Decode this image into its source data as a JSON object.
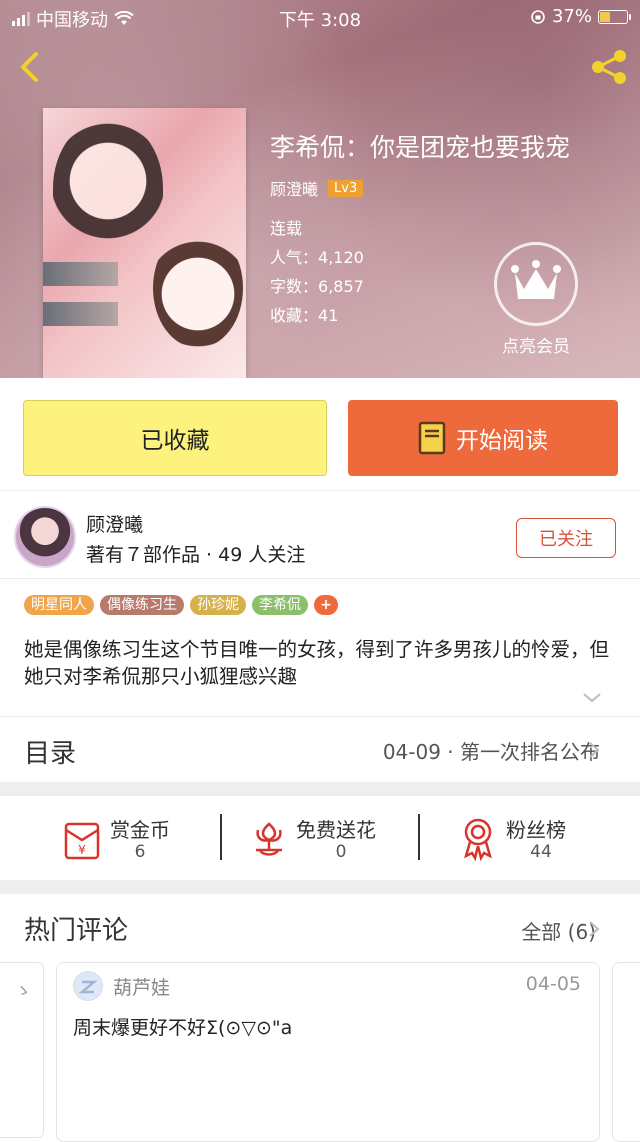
{
  "status_bar": {
    "carrier": "中国移动",
    "time": "下午 3:08",
    "battery": "37%"
  },
  "book": {
    "title": "李希侃：你是团宠也要我宠",
    "author": "顾澄曦",
    "author_level": "Lv3",
    "status": "连载",
    "popularity_label": "人气：",
    "popularity": "4,120",
    "word_count_label": "字数：",
    "word_count": "6,857",
    "favorites_label": "收藏：",
    "favorites": "41"
  },
  "vip": {
    "label": "点亮会员"
  },
  "actions": {
    "collected_label": "已收藏",
    "read_label": "开始阅读"
  },
  "author_card": {
    "name": "顾澄曦",
    "stats": "著有７部作品 · 49 人关注",
    "follow_label": "已关注"
  },
  "tags": [
    {
      "label": "明星同人",
      "color": "#f0a54a"
    },
    {
      "label": "偶像练习生",
      "color": "#b97a6e"
    },
    {
      "label": "孙珍妮",
      "color": "#d6b04a"
    },
    {
      "label": "李希侃",
      "color": "#8bbf6a"
    },
    {
      "label": "+",
      "color": "#ee6a3d"
    }
  ],
  "intro": "她是偶像练习生这个节目唯一的女孩，得到了许多男孩儿的怜爱，但她只对李希侃那只小狐狸感兴趣",
  "toc": {
    "label": "目录",
    "latest": "04-09 · 第一次排名公布"
  },
  "stats": [
    {
      "label": "赏金币",
      "value": "6",
      "icon": "red-envelope-icon"
    },
    {
      "label": "免费送花",
      "value": "0",
      "icon": "flower-icon"
    },
    {
      "label": "粉丝榜",
      "value": "44",
      "icon": "medal-icon"
    }
  ],
  "comments": {
    "label": "热门评论",
    "all_label": "全部 (6)",
    "items": [
      {
        "user": "葫芦娃",
        "date": "04-05",
        "text": "周末爆更好不好Σ(⊙▽⊙\"a"
      }
    ]
  },
  "colors": {
    "accent_orange": "#ee6a3d",
    "collect_yellow": "#fdf27e",
    "follow_red": "#d9533a",
    "level_badge": "#f0a030"
  }
}
